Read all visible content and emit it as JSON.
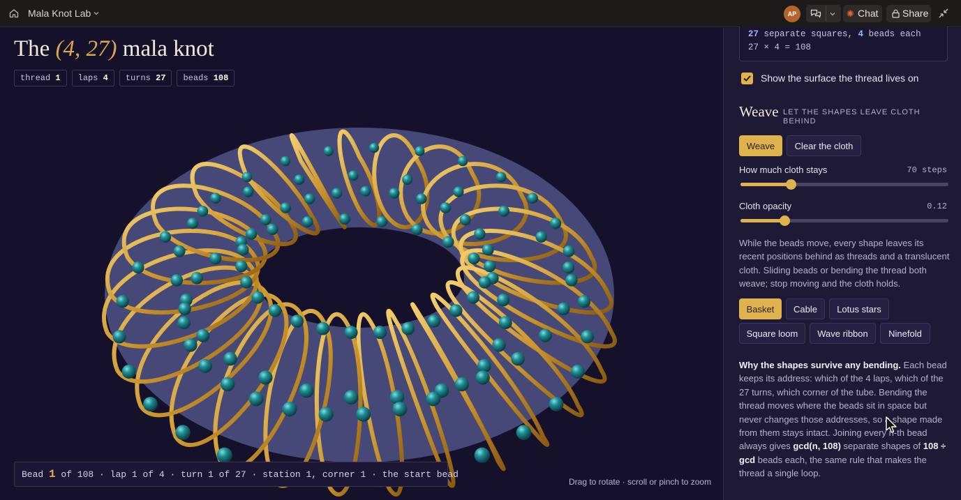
{
  "topbar": {
    "app_name": "Mala Knot Lab",
    "avatar_initials": "AP",
    "chat_label": "Chat",
    "share_label": "Share"
  },
  "header": {
    "title_pre": "The ",
    "title_accent": "(4, 27)",
    "title_post": " mala knot"
  },
  "stats": [
    {
      "label": "thread",
      "value": "1"
    },
    {
      "label": "laps",
      "value": "4"
    },
    {
      "label": "turns",
      "value": "27"
    },
    {
      "label": "beads",
      "value": "108"
    }
  ],
  "status": {
    "prefix": "Bead ",
    "bead": "1",
    "suffix": " of 108 · lap 1 of 4 · turn 1 of 27 · station 1, corner 1 · the start bead",
    "hint": "Drag to rotate · scroll or pinch to zoom"
  },
  "panel": {
    "code": {
      "line1_n1": "27",
      "line1_mid": " separate squares, ",
      "line1_n2": "4",
      "line1_end": " beads each",
      "line2": "27 × 4 = 108"
    },
    "surface_label": "Show the surface the thread lives on",
    "surface_checked": true,
    "weave_title": "Weave",
    "weave_sub": "LET THE SHAPES LEAVE CLOTH BEHIND",
    "weave_button": "Weave",
    "clear_button": "Clear the cloth",
    "cloth_stays": {
      "label": "How much cloth stays",
      "value": "70 steps",
      "fraction": 0.24
    },
    "cloth_opacity": {
      "label": "Cloth opacity",
      "value": "0.12",
      "fraction": 0.21
    },
    "description": "While the beads move, every shape leaves its recent positions behind as threads and a translucent cloth. Sliding beads or bending the thread both weave; stop moving and the cloth holds.",
    "patterns": [
      "Basket",
      "Cable",
      "Lotus stars",
      "Square loom",
      "Wave ribbon",
      "Ninefold"
    ],
    "active_pattern": "Basket",
    "why_title": "Why the shapes survive any bending.",
    "why_text": " Each bead keeps its address: which of the 4 laps, which of the 27 turns, which corner of the tube. Bending the thread moves where the beads sit in space but never changes those addresses, so a shape made from them stays intact. Joining every n-th bead always gives ",
    "why_gcd": "gcd(n, 108)",
    "why_mid": " separate shapes of ",
    "why_ratio": "108 ÷ gcd",
    "why_end": " beads each, the same rule that makes the thread a single loop."
  },
  "colors": {
    "accent": "#e0b24e",
    "background": "#15112a",
    "bead": "#1f8e94",
    "thread": "#c8922b",
    "surface": "#7077b8"
  },
  "icons": [
    "home-icon",
    "chevron-down-icon",
    "conversations-icon",
    "chat-spark-icon",
    "lock-icon",
    "collapse-icon",
    "check-icon",
    "cursor-icon"
  ]
}
